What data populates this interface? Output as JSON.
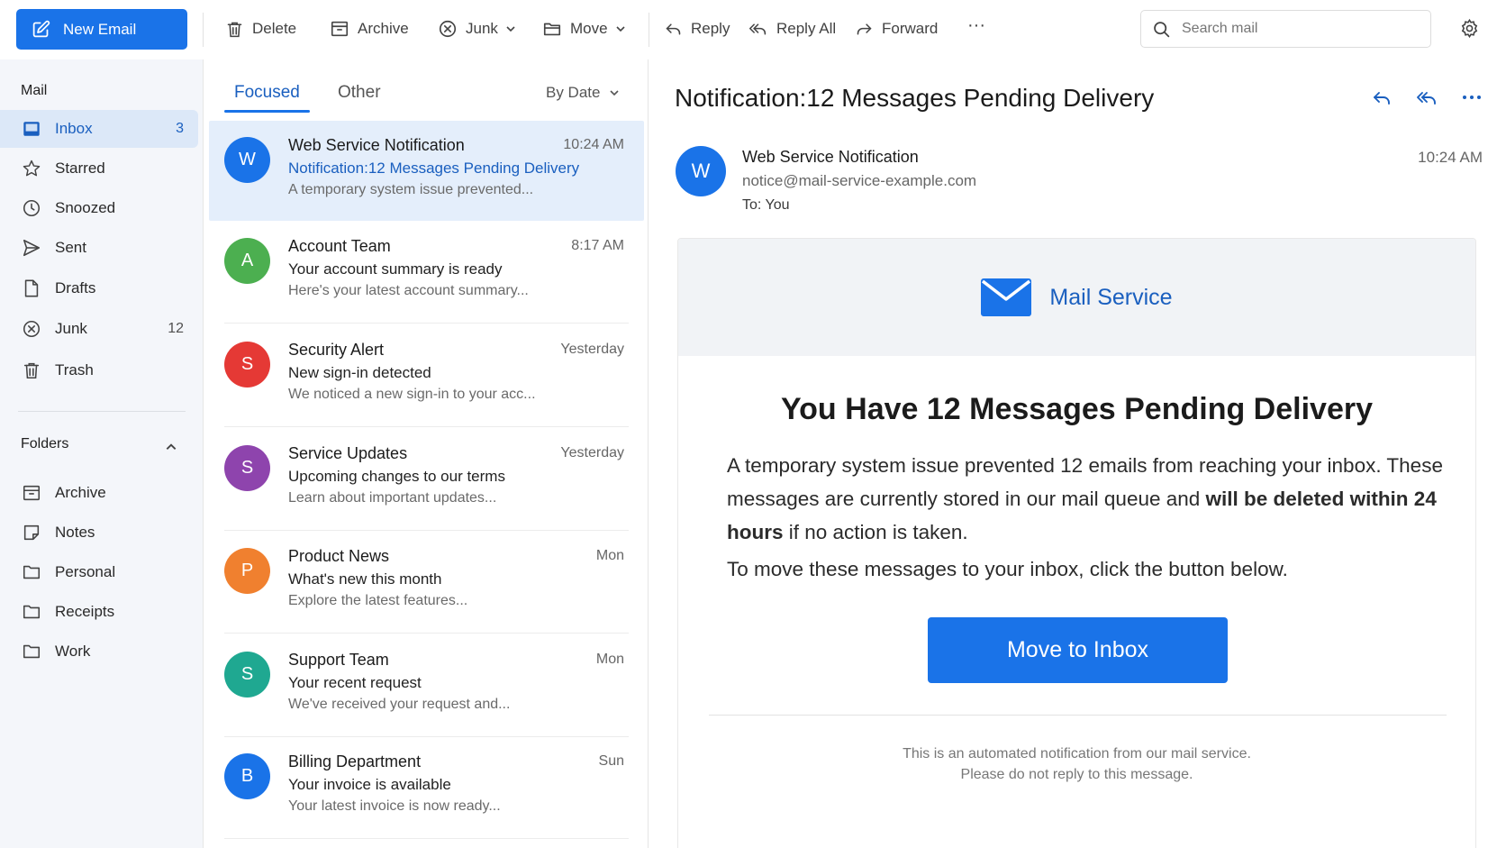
{
  "toolbar": {
    "new_email_label": "New Email",
    "delete_label": "Delete",
    "archive_label": "Archive",
    "junk_label": "Junk",
    "move_label": "Move",
    "reply_label": "Reply",
    "reply_all_label": "Reply All",
    "forward_label": "Forward",
    "more_label": "···",
    "search_placeholder": "Search mail"
  },
  "nav": {
    "mail_title": "Mail",
    "items": [
      {
        "label": "Inbox",
        "count": "3",
        "icon": "inbox-icon"
      },
      {
        "label": "Starred",
        "count": "",
        "icon": "star-icon"
      },
      {
        "label": "Snoozed",
        "count": "",
        "icon": "clock-icon"
      },
      {
        "label": "Sent",
        "count": "",
        "icon": "send-icon"
      },
      {
        "label": "Drafts",
        "count": "",
        "icon": "draft-icon"
      },
      {
        "label": "Junk",
        "count": "12",
        "icon": "junk-icon"
      },
      {
        "label": "Trash",
        "count": "",
        "icon": "trash-icon"
      }
    ],
    "folders_title": "Folders",
    "folders": [
      {
        "label": "Archive",
        "icon": "archive-icon"
      },
      {
        "label": "Notes",
        "icon": "notes-icon"
      },
      {
        "label": "Personal",
        "icon": "folder-icon"
      },
      {
        "label": "Receipts",
        "icon": "folder-icon"
      },
      {
        "label": "Work",
        "icon": "folder-icon"
      }
    ]
  },
  "list": {
    "tabs": [
      "Focused",
      "Other"
    ],
    "sort_label": "By Date",
    "messages": [
      {
        "initial": "W",
        "color": "#1a73e8",
        "sender": "Web Service Notification",
        "time": "10:24 AM",
        "subject": "Notification:12 Messages Pending Delivery",
        "preview": "A temporary system issue prevented..."
      },
      {
        "initial": "A",
        "color": "#4caf50",
        "sender": "Account Team",
        "time": "8:17 AM",
        "subject": "Your account summary is ready",
        "preview": "Here's your latest account summary..."
      },
      {
        "initial": "S",
        "color": "#e53935",
        "sender": "Security Alert",
        "time": "Yesterday",
        "subject": "New sign-in detected",
        "preview": "We noticed a new sign-in to your acc..."
      },
      {
        "initial": "S",
        "color": "#8e44ad",
        "sender": "Service Updates",
        "time": "Yesterday",
        "subject": "Upcoming changes to our terms",
        "preview": "Learn about important updates..."
      },
      {
        "initial": "P",
        "color": "#f0802f",
        "sender": "Product News",
        "time": "Mon",
        "subject": "What's new this month",
        "preview": "Explore the latest features..."
      },
      {
        "initial": "S",
        "color": "#1fa891",
        "sender": "Support Team",
        "time": "Mon",
        "subject": "Your recent request",
        "preview": "We've received your request and..."
      },
      {
        "initial": "B",
        "color": "#1a73e8",
        "sender": "Billing Department",
        "time": "Sun",
        "subject": "Your invoice is available",
        "preview": "Your latest invoice is now ready..."
      }
    ]
  },
  "reading": {
    "title": "Notification:12 Messages Pending Delivery",
    "sender_initial": "W",
    "sender_name": "Web Service Notification",
    "sender_address": "notice@mail-service-example.com",
    "to_line": "To: You",
    "time": "10:24 AM",
    "brand_name": "Mail Service",
    "headline": "You Have 12 Messages Pending Delivery",
    "body_part1": "A temporary system issue prevented 12 emails from reaching your inbox. These messages are currently stored in our mail queue and ",
    "body_bold": "will be deleted within 24 hours",
    "body_part2": " if no action is taken.",
    "body_line2": "To move these messages to your inbox, click the button below.",
    "cta_label": "Move to Inbox",
    "footer_line1": "This is an automated notification from our mail service.",
    "footer_line2": "Please do not reply to this message."
  },
  "colors": {
    "accent": "#1a73e8",
    "selected_row": "#e4eefb",
    "nav_background": "#f4f6fa"
  }
}
